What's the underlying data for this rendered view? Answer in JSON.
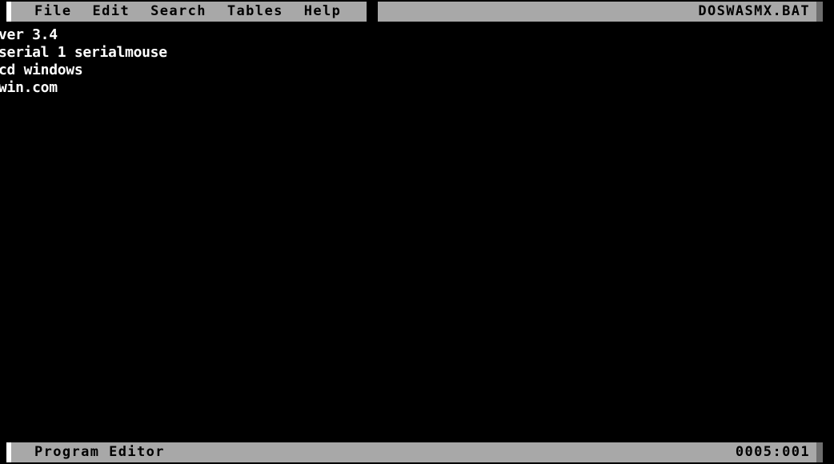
{
  "window": {
    "filename": "DOSWASMX.BAT",
    "app_name": "Program Editor"
  },
  "menubar": {
    "items": [
      {
        "label": "File"
      },
      {
        "label": "Edit"
      },
      {
        "label": "Search"
      },
      {
        "label": "Tables"
      },
      {
        "label": "Help"
      }
    ]
  },
  "editor": {
    "lines": [
      {
        "text": "ver 3.4"
      },
      {
        "text": "serial 1 serialmouse"
      },
      {
        "text": "cd windows"
      },
      {
        "text": "win.com"
      }
    ]
  },
  "statusbar": {
    "label": "Program Editor",
    "cursor_position": "0005:001"
  },
  "colors": {
    "background": "#000000",
    "bar_gray": "#a8a8a8",
    "scroll_gray": "#6e6e6e",
    "text_white": "#ffffff",
    "bar_text": "#000000",
    "marker_white": "#ffffff"
  }
}
